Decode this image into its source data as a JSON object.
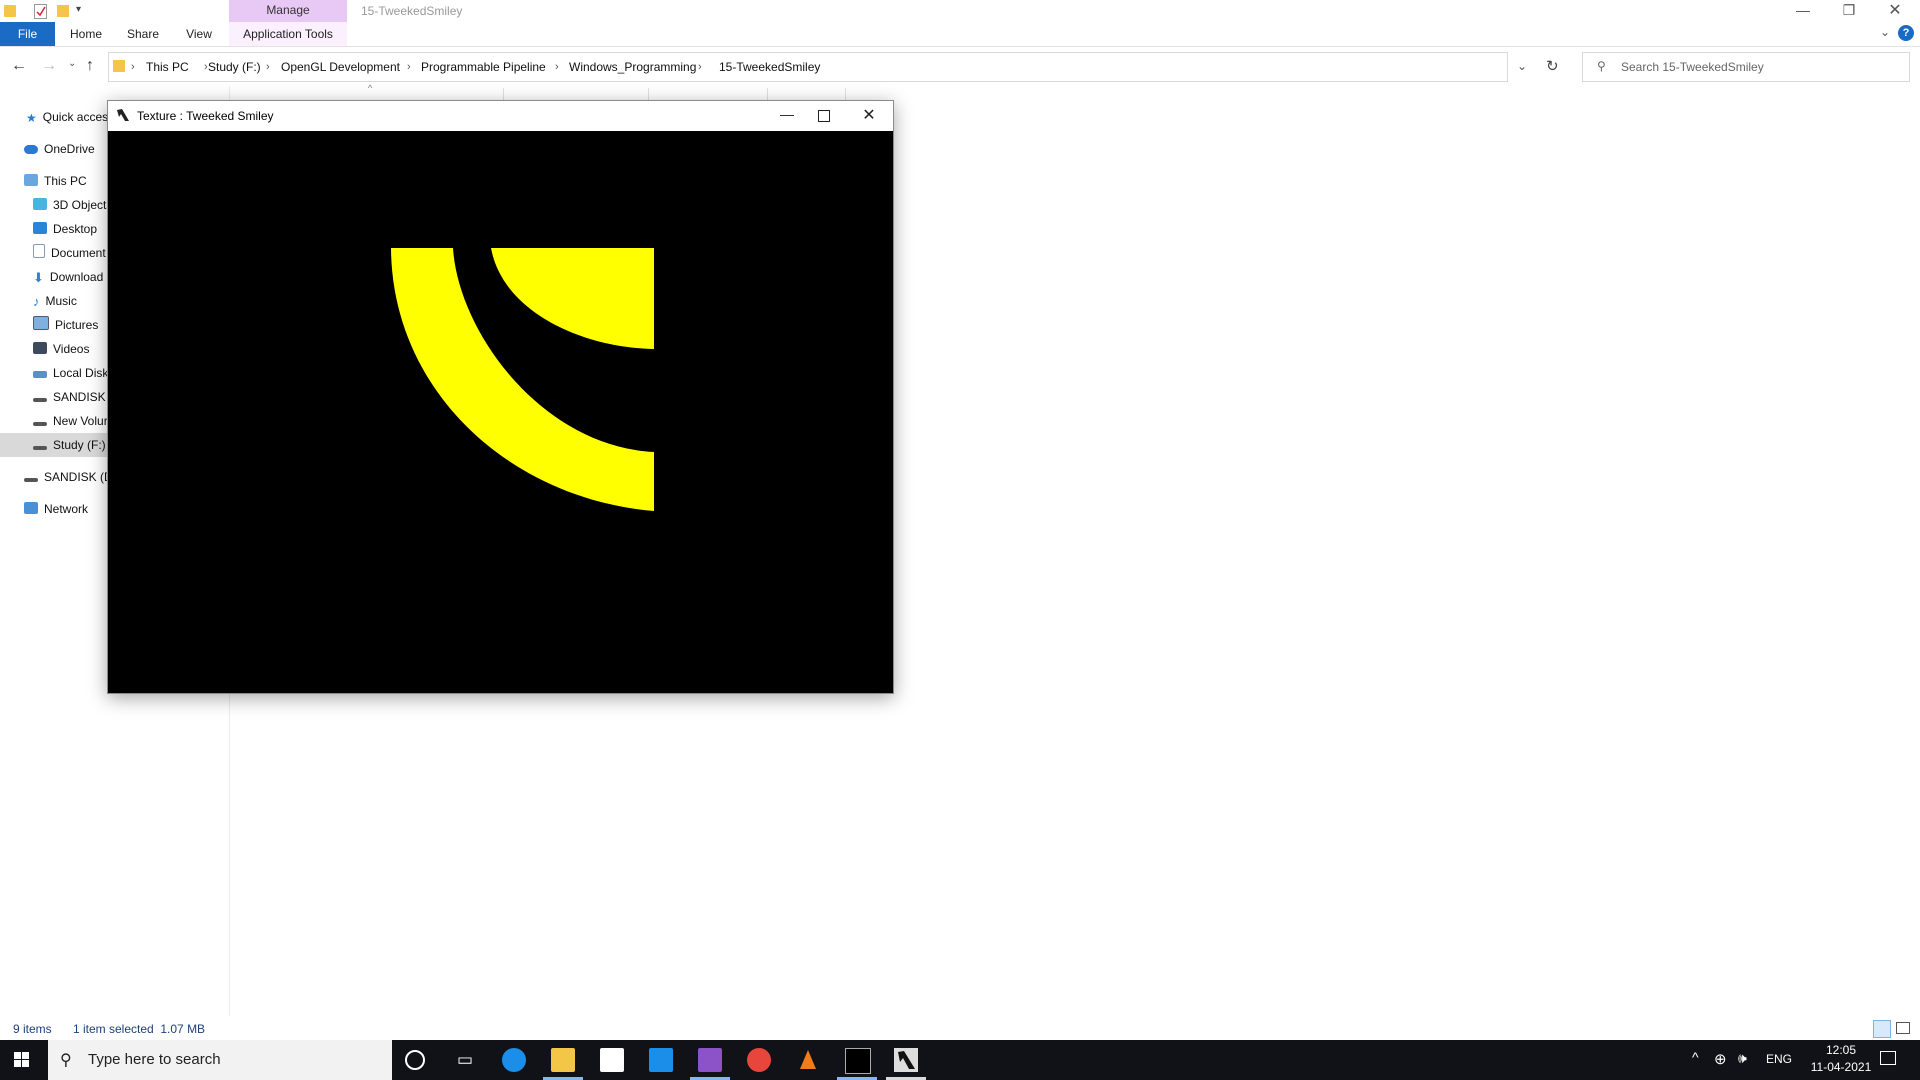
{
  "explorer": {
    "title": "15-TweekedSmiley",
    "ribbon": {
      "file": "File",
      "home": "Home",
      "share": "Share",
      "view": "View",
      "manage": "Manage",
      "application_tools": "Application Tools"
    },
    "breadcrumb": [
      "This PC",
      "Study (F:)",
      "OpenGL Development",
      "Programmable Pipeline",
      "Windows_Programming",
      "15-TweekedSmiley"
    ],
    "search_placeholder": "Search 15-TweekedSmiley",
    "nav": {
      "quick_access": "Quick acces",
      "onedrive": "OneDrive",
      "this_pc": "This PC",
      "objects3d": "3D Objects",
      "desktop": "Desktop",
      "documents": "Document",
      "downloads": "Download",
      "music": "Music",
      "pictures": "Pictures",
      "videos": "Videos",
      "local_disk": "Local Disk",
      "sandisk1": "SANDISK (",
      "new_volume": "New Volur",
      "study": "Study (F:)",
      "sandisk2": "SANDISK (D",
      "network": "Network"
    },
    "status": {
      "items": "9 items",
      "selected": "1 item selected  1.07 MB"
    }
  },
  "glwindow": {
    "title": "Texture : Tweeked Smiley",
    "fill_color": "#ffff00",
    "background_color": "#000000"
  },
  "taskbar": {
    "search_placeholder": "Type here to search",
    "lang": "ENG",
    "time": "12:05",
    "date": "11-04-2021"
  },
  "colors": {
    "accent": "#1a6bc6",
    "manage_tab": "#e8c8f5",
    "taskbar": "#101217"
  }
}
